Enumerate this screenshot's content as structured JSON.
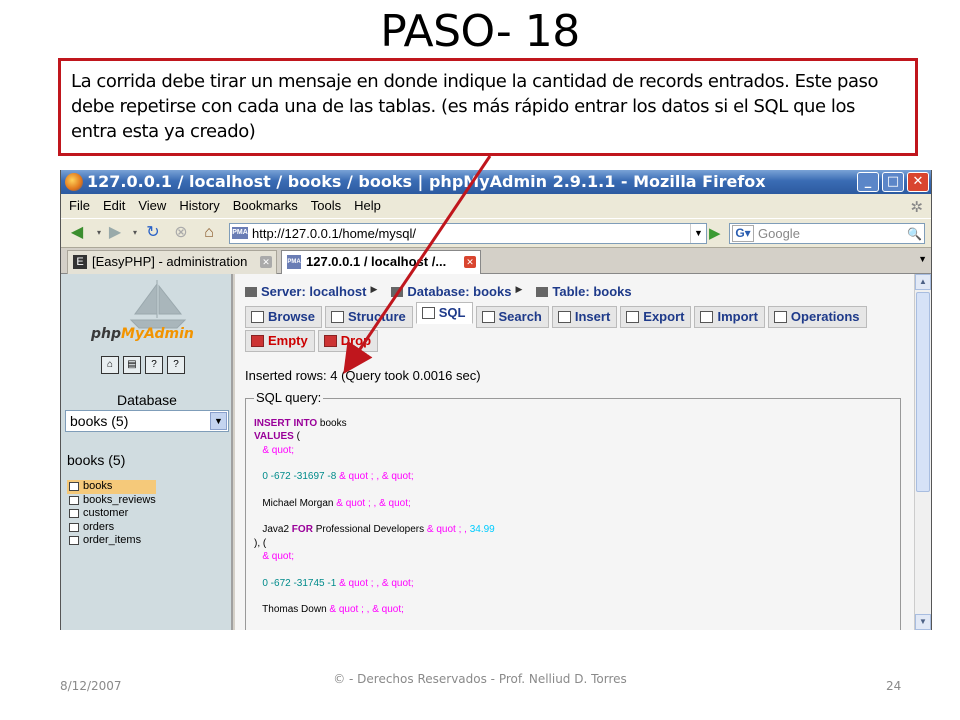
{
  "slide": {
    "title": "PASO- 18",
    "callout": "La corrida debe tirar un mensaje en donde indique la cantidad de records entrados. Este paso debe repetirse con cada una de las tablas. (es más rápido entrar los datos si el SQL que los entra esta ya creado)",
    "footer_date": "8/12/2007",
    "footer_credit": "© - Derechos Reservados - Prof. Nelliud D. Torres",
    "page_number": "24",
    "annotation_color": "#c0161d"
  },
  "browser": {
    "title": "127.0.0.1 / localhost / books / books | phpMyAdmin 2.9.1.1 - Mozilla Firefox",
    "menu": [
      "File",
      "Edit",
      "View",
      "History",
      "Bookmarks",
      "Tools",
      "Help"
    ],
    "url": "http://127.0.0.1/home/mysql/",
    "search_placeholder": "Google",
    "tabs": [
      "[EasyPHP] - administration",
      "127.0.0.1 / localhost /..."
    ]
  },
  "sidebar": {
    "logo_php": "php",
    "logo_myadmin": "MyAdmin",
    "database_label": "Database",
    "selected_db": "books (5)",
    "db_heading": "books (5)",
    "tables": [
      "books",
      "books_reviews",
      "customer",
      "orders",
      "order_items"
    ]
  },
  "main": {
    "breadcrumb": {
      "server": "Server: localhost",
      "database": "Database: books",
      "table": "Table: books"
    },
    "tabs_row1": [
      "Browse",
      "Structure",
      "SQL",
      "Search",
      "Insert",
      "Export",
      "Import",
      "Operations"
    ],
    "tabs_row2": [
      "Empty",
      "Drop"
    ],
    "inserted_msg": "Inserted rows: 4 (Query took 0.0016 sec)",
    "sql_legend": "SQL query:",
    "sql": {
      "l1a": "INSERT INTO",
      "l1b": " books",
      "l2a": "VALUES",
      "l2b": " (",
      "quot": "& quot",
      "semi": ";",
      "semicomma": " ; ,",
      "comma": " ,",
      "r1nums": "0 -672 -31697 -8",
      "r1name": "Michael Morgan",
      "r1java": "Java2",
      "r1for": " FOR",
      "r1rest": " Professional Developers",
      "r1price": " 34.99",
      "close": "), (",
      "r2nums": "0 -672 -31745 -1",
      "r2name": "Thomas Down"
    }
  }
}
